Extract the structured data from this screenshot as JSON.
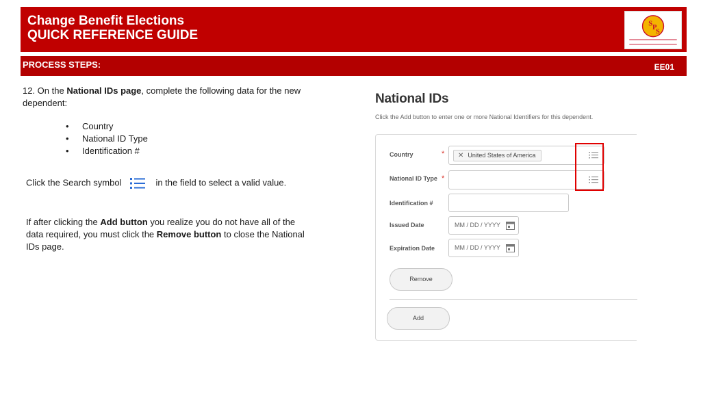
{
  "header": {
    "title_line1": "Change Benefit Elections",
    "title_line2": "QUICK REFERENCE GUIDE",
    "logo_icon": "sps-logo",
    "brand_color": "#c00000"
  },
  "process_bar": {
    "label": "PROCESS STEPS:",
    "code": "EE01"
  },
  "instructions": {
    "intro_prefix": "12.  On the ",
    "intro_bold": "National IDs page",
    "intro_suffix": ", complete the following data for the new dependent:",
    "bullets": [
      "Country",
      "National ID Type",
      "Identification #"
    ],
    "search_prefix": "Click the Search symbol",
    "search_icon": "list-search-icon",
    "search_suffix": "in the field to select a valid value.",
    "para_p1": "If after clicking the ",
    "para_b1": "Add button",
    "para_p2": " you realize you do not have all of the data required, you must click the ",
    "para_b2": "Remove button",
    "para_p3": " to close the National IDs page."
  },
  "screenshot": {
    "title": "National IDs",
    "subtitle": "Click the Add button to enter one or more National Identifiers for this dependent.",
    "fields": {
      "country_label": "Country",
      "country_value": "United States of America",
      "national_id_type_label": "National ID Type",
      "identification_label": "Identification #",
      "issued_date_label": "Issued Date",
      "issued_date_placeholder": "MM / DD / YYYY",
      "expiration_date_label": "Expiration Date",
      "expiration_date_placeholder": "MM / DD / YYYY"
    },
    "remove_button": "Remove",
    "add_button": "Add",
    "required_marker": "*"
  }
}
